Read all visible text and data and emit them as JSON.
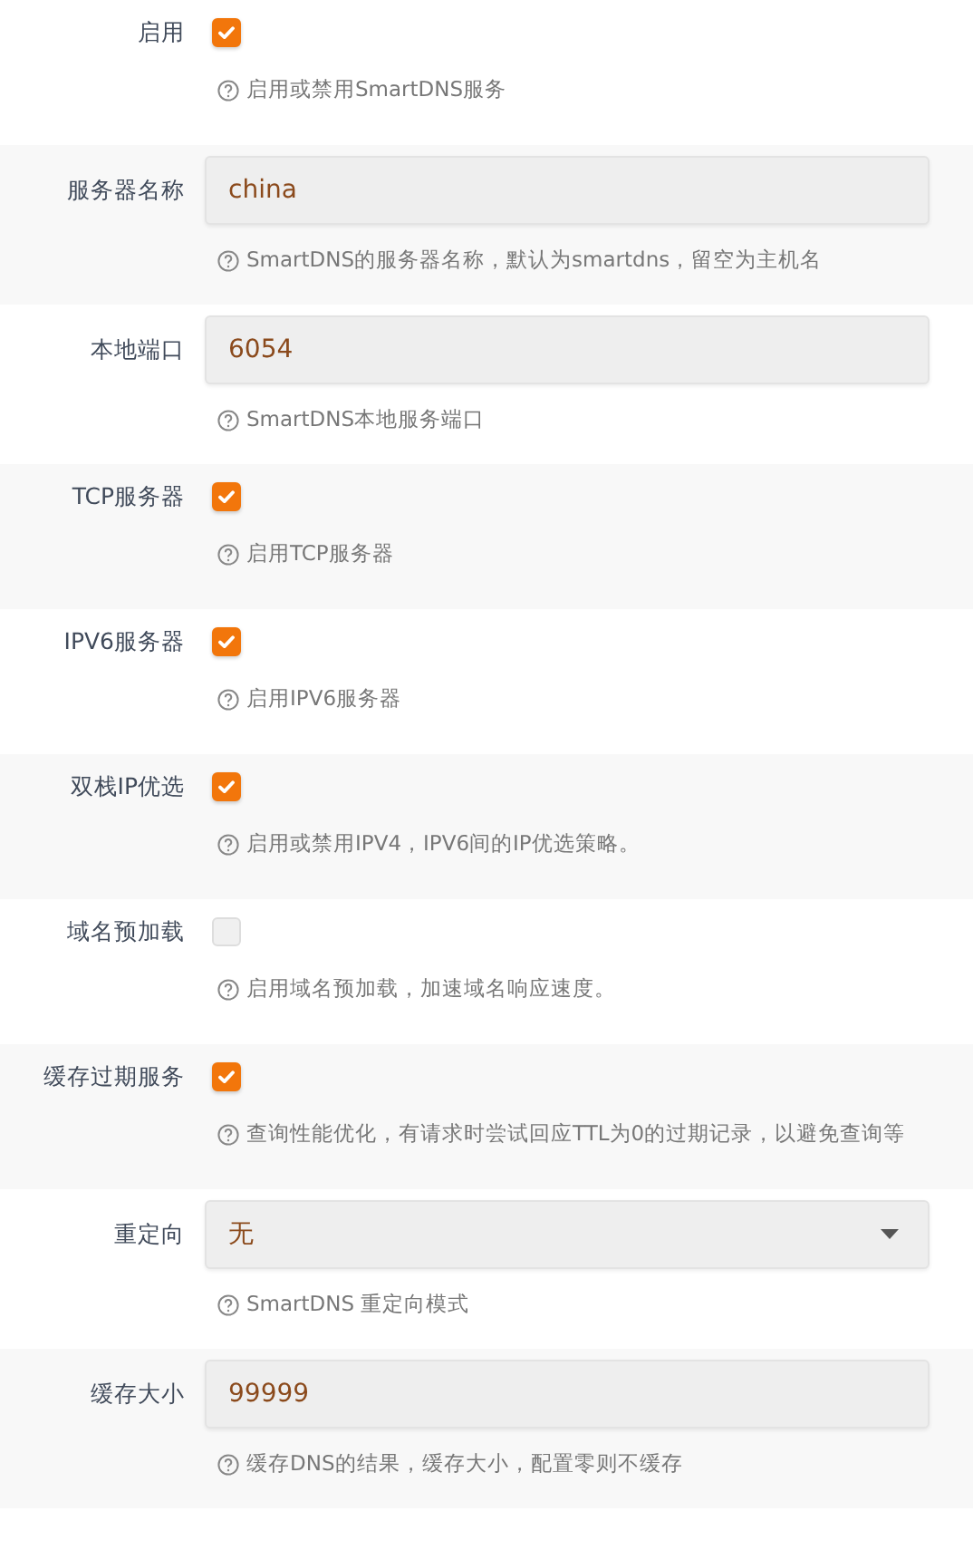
{
  "rows": [
    {
      "label": "启用",
      "kind": "checkbox",
      "checked": true,
      "help": "启用或禁用SmartDNS服务"
    },
    {
      "label": "服务器名称",
      "kind": "text",
      "value": "china",
      "help": "SmartDNS的服务器名称，默认为smartdns，留空为主机名"
    },
    {
      "label": "本地端口",
      "kind": "text",
      "value": "6054",
      "help": "SmartDNS本地服务端口"
    },
    {
      "label": "TCP服务器",
      "kind": "checkbox",
      "checked": true,
      "help": "启用TCP服务器"
    },
    {
      "label": "IPV6服务器",
      "kind": "checkbox",
      "checked": true,
      "help": "启用IPV6服务器"
    },
    {
      "label": "双栈IP优选",
      "kind": "checkbox",
      "checked": true,
      "help": "启用或禁用IPV4，IPV6间的IP优选策略。"
    },
    {
      "label": "域名预加载",
      "kind": "checkbox",
      "checked": false,
      "help": "启用域名预加载，加速域名响应速度。"
    },
    {
      "label": "缓存过期服务",
      "kind": "checkbox",
      "checked": true,
      "help": "查询性能优化，有请求时尝试回应TTL为0的过期记录，以避免查询等"
    },
    {
      "label": "重定向",
      "kind": "select",
      "value": "无",
      "help": "SmartDNS 重定向模式"
    },
    {
      "label": "缓存大小",
      "kind": "text",
      "value": "99999",
      "help": "缓存DNS的结果，缓存大小，配置零则不缓存"
    }
  ]
}
